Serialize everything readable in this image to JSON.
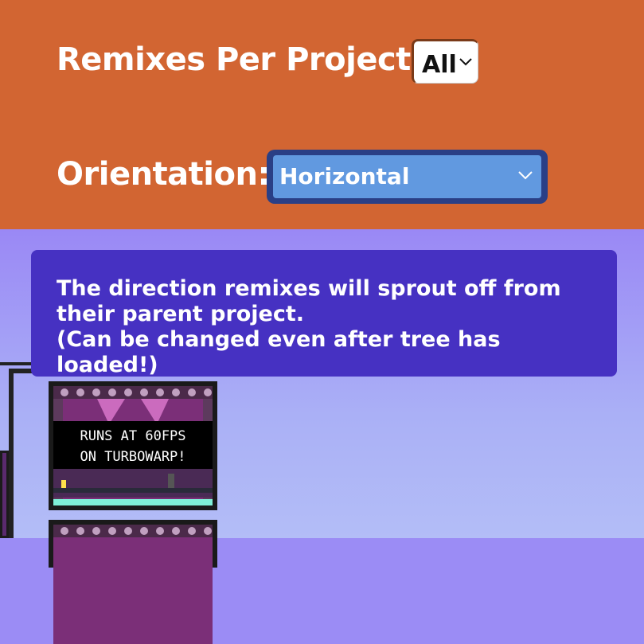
{
  "settings": {
    "remixes_per_project": {
      "label": "Remixes Per Project:",
      "selected": "All"
    },
    "orientation": {
      "label": "Orientation:",
      "selected": "Horizontal"
    }
  },
  "tooltip": {
    "line1": "The direction remixes will sprout off from their parent project.",
    "line2": "(Can be changed even after tree has loaded!)"
  },
  "projects": [
    {
      "thumbnail_text_line1": "RUNS AT 60FPS",
      "thumbnail_text_line2": "ON TURBOWARP!"
    }
  ],
  "colors": {
    "header_bg": "#d26532",
    "tree_bg": "#9b8cf5",
    "tooltip_bg": "#4631c2",
    "orientation_select_bg": "#6199e0"
  }
}
